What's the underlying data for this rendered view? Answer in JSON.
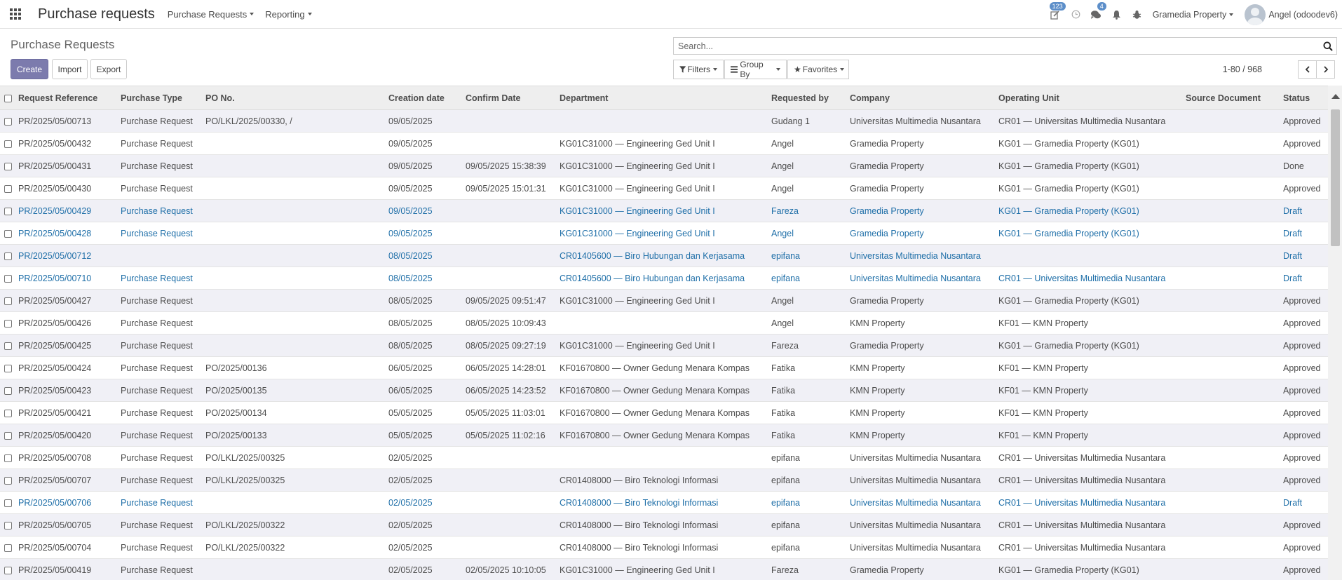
{
  "navbar": {
    "app_title": "Purchase requests",
    "menus": [
      "Purchase Requests",
      "Reporting"
    ],
    "activity_badge": "123",
    "messages_badge": "4",
    "company": "Gramedia Property",
    "user": "Angel (odoodev6)"
  },
  "control": {
    "breadcrumb": "Purchase Requests",
    "create_label": "Create",
    "import_label": "Import",
    "export_label": "Export",
    "search_placeholder": "Search...",
    "filters_label": "Filters",
    "groupby_label": "Group By",
    "favorites_label": "Favorites",
    "pager": "1-80 / 968"
  },
  "table": {
    "columns": [
      "Request Reference",
      "Purchase Type",
      "PO No.",
      "Creation date",
      "Confirm Date",
      "Department",
      "Requested by",
      "Company",
      "Operating Unit",
      "Source Document",
      "Status"
    ],
    "rows": [
      {
        "ref": "PR/2025/05/00713",
        "type": "Purchase Request",
        "po": "PO/LKL/2025/00330, /",
        "created": "09/05/2025",
        "confirm": "",
        "dept": "",
        "by": "Gudang 1",
        "company": "Universitas Multimedia Nusantara",
        "ou": "CR01 — Universitas Multimedia Nusantara",
        "source": "",
        "status": "Approved",
        "draft": false
      },
      {
        "ref": "PR/2025/05/00432",
        "type": "Purchase Request",
        "po": "",
        "created": "09/05/2025",
        "confirm": "",
        "dept": "KG01C31000 — Engineering Ged Unit I",
        "by": "Angel",
        "company": "Gramedia Property",
        "ou": "KG01 — Gramedia Property (KG01)",
        "source": "",
        "status": "Approved",
        "draft": false
      },
      {
        "ref": "PR/2025/05/00431",
        "type": "Purchase Request",
        "po": "",
        "created": "09/05/2025",
        "confirm": "09/05/2025 15:38:39",
        "dept": "KG01C31000 — Engineering Ged Unit I",
        "by": "Angel",
        "company": "Gramedia Property",
        "ou": "KG01 — Gramedia Property (KG01)",
        "source": "",
        "status": "Done",
        "draft": false
      },
      {
        "ref": "PR/2025/05/00430",
        "type": "Purchase Request",
        "po": "",
        "created": "09/05/2025",
        "confirm": "09/05/2025 15:01:31",
        "dept": "KG01C31000 — Engineering Ged Unit I",
        "by": "Angel",
        "company": "Gramedia Property",
        "ou": "KG01 — Gramedia Property (KG01)",
        "source": "",
        "status": "Approved",
        "draft": false
      },
      {
        "ref": "PR/2025/05/00429",
        "type": "Purchase Request",
        "po": "",
        "created": "09/05/2025",
        "confirm": "",
        "dept": "KG01C31000 — Engineering Ged Unit I",
        "by": "Fareza",
        "company": "Gramedia Property",
        "ou": "KG01 — Gramedia Property (KG01)",
        "source": "",
        "status": "Draft",
        "draft": true
      },
      {
        "ref": "PR/2025/05/00428",
        "type": "Purchase Request",
        "po": "",
        "created": "09/05/2025",
        "confirm": "",
        "dept": "KG01C31000 — Engineering Ged Unit I",
        "by": "Angel",
        "company": "Gramedia Property",
        "ou": "KG01 — Gramedia Property (KG01)",
        "source": "",
        "status": "Draft",
        "draft": true
      },
      {
        "ref": "PR/2025/05/00712",
        "type": "",
        "po": "",
        "created": "08/05/2025",
        "confirm": "",
        "dept": "CR01405600 — Biro Hubungan dan Kerjasama",
        "by": "epifana",
        "company": "Universitas Multimedia Nusantara",
        "ou": "",
        "source": "",
        "status": "Draft",
        "draft": true
      },
      {
        "ref": "PR/2025/05/00710",
        "type": "Purchase Request",
        "po": "",
        "created": "08/05/2025",
        "confirm": "",
        "dept": "CR01405600 — Biro Hubungan dan Kerjasama",
        "by": "epifana",
        "company": "Universitas Multimedia Nusantara",
        "ou": "CR01 — Universitas Multimedia Nusantara",
        "source": "",
        "status": "Draft",
        "draft": true
      },
      {
        "ref": "PR/2025/05/00427",
        "type": "Purchase Request",
        "po": "",
        "created": "08/05/2025",
        "confirm": "09/05/2025 09:51:47",
        "dept": "KG01C31000 — Engineering Ged Unit I",
        "by": "Angel",
        "company": "Gramedia Property",
        "ou": "KG01 — Gramedia Property (KG01)",
        "source": "",
        "status": "Approved",
        "draft": false
      },
      {
        "ref": "PR/2025/05/00426",
        "type": "Purchase Request",
        "po": "",
        "created": "08/05/2025",
        "confirm": "08/05/2025 10:09:43",
        "dept": "",
        "by": "Angel",
        "company": "KMN Property",
        "ou": "KF01 — KMN Property",
        "source": "",
        "status": "Approved",
        "draft": false
      },
      {
        "ref": "PR/2025/05/00425",
        "type": "Purchase Request",
        "po": "",
        "created": "08/05/2025",
        "confirm": "08/05/2025 09:27:19",
        "dept": "KG01C31000 — Engineering Ged Unit I",
        "by": "Fareza",
        "company": "Gramedia Property",
        "ou": "KG01 — Gramedia Property (KG01)",
        "source": "",
        "status": "Approved",
        "draft": false
      },
      {
        "ref": "PR/2025/05/00424",
        "type": "Purchase Request",
        "po": "PO/2025/00136",
        "created": "06/05/2025",
        "confirm": "06/05/2025 14:28:01",
        "dept": "KF01670800 — Owner Gedung Menara Kompas",
        "by": "Fatika",
        "company": "KMN Property",
        "ou": "KF01 — KMN Property",
        "source": "",
        "status": "Approved",
        "draft": false
      },
      {
        "ref": "PR/2025/05/00423",
        "type": "Purchase Request",
        "po": "PO/2025/00135",
        "created": "06/05/2025",
        "confirm": "06/05/2025 14:23:52",
        "dept": "KF01670800 — Owner Gedung Menara Kompas",
        "by": "Fatika",
        "company": "KMN Property",
        "ou": "KF01 — KMN Property",
        "source": "",
        "status": "Approved",
        "draft": false
      },
      {
        "ref": "PR/2025/05/00421",
        "type": "Purchase Request",
        "po": "PO/2025/00134",
        "created": "05/05/2025",
        "confirm": "05/05/2025 11:03:01",
        "dept": "KF01670800 — Owner Gedung Menara Kompas",
        "by": "Fatika",
        "company": "KMN Property",
        "ou": "KF01 — KMN Property",
        "source": "",
        "status": "Approved",
        "draft": false
      },
      {
        "ref": "PR/2025/05/00420",
        "type": "Purchase Request",
        "po": "PO/2025/00133",
        "created": "05/05/2025",
        "confirm": "05/05/2025 11:02:16",
        "dept": "KF01670800 — Owner Gedung Menara Kompas",
        "by": "Fatika",
        "company": "KMN Property",
        "ou": "KF01 — KMN Property",
        "source": "",
        "status": "Approved",
        "draft": false
      },
      {
        "ref": "PR/2025/05/00708",
        "type": "Purchase Request",
        "po": "PO/LKL/2025/00325",
        "created": "02/05/2025",
        "confirm": "",
        "dept": "",
        "by": "epifana",
        "company": "Universitas Multimedia Nusantara",
        "ou": "CR01 — Universitas Multimedia Nusantara",
        "source": "",
        "status": "Approved",
        "draft": false
      },
      {
        "ref": "PR/2025/05/00707",
        "type": "Purchase Request",
        "po": "PO/LKL/2025/00325",
        "created": "02/05/2025",
        "confirm": "",
        "dept": "CR01408000 — Biro Teknologi Informasi",
        "by": "epifana",
        "company": "Universitas Multimedia Nusantara",
        "ou": "CR01 — Universitas Multimedia Nusantara",
        "source": "",
        "status": "Approved",
        "draft": false
      },
      {
        "ref": "PR/2025/05/00706",
        "type": "Purchase Request",
        "po": "",
        "created": "02/05/2025",
        "confirm": "",
        "dept": "CR01408000 — Biro Teknologi Informasi",
        "by": "epifana",
        "company": "Universitas Multimedia Nusantara",
        "ou": "CR01 — Universitas Multimedia Nusantara",
        "source": "",
        "status": "Draft",
        "draft": true
      },
      {
        "ref": "PR/2025/05/00705",
        "type": "Purchase Request",
        "po": "PO/LKL/2025/00322",
        "created": "02/05/2025",
        "confirm": "",
        "dept": "CR01408000 — Biro Teknologi Informasi",
        "by": "epifana",
        "company": "Universitas Multimedia Nusantara",
        "ou": "CR01 — Universitas Multimedia Nusantara",
        "source": "",
        "status": "Approved",
        "draft": false
      },
      {
        "ref": "PR/2025/05/00704",
        "type": "Purchase Request",
        "po": "PO/LKL/2025/00322",
        "created": "02/05/2025",
        "confirm": "",
        "dept": "CR01408000 — Biro Teknologi Informasi",
        "by": "epifana",
        "company": "Universitas Multimedia Nusantara",
        "ou": "CR01 — Universitas Multimedia Nusantara",
        "source": "",
        "status": "Approved",
        "draft": false
      },
      {
        "ref": "PR/2025/05/00419",
        "type": "Purchase Request",
        "po": "",
        "created": "02/05/2025",
        "confirm": "02/05/2025 10:10:05",
        "dept": "KG01C31000 — Engineering Ged Unit I",
        "by": "Fareza",
        "company": "Gramedia Property",
        "ou": "KG01 — Gramedia Property (KG01)",
        "source": "",
        "status": "Approved",
        "draft": false
      }
    ]
  }
}
